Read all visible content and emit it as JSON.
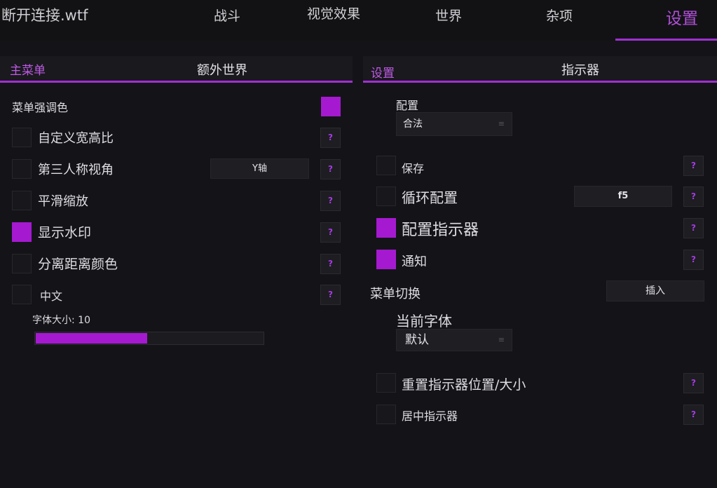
{
  "app": {
    "title": "断开连接.wtf"
  },
  "tabs": [
    {
      "label": "战斗"
    },
    {
      "label": "视觉效果"
    },
    {
      "label": "世界"
    },
    {
      "label": "杂项"
    },
    {
      "label": "设置"
    }
  ],
  "left_panel": {
    "section": "主菜单",
    "subtitle": "额外世界",
    "accent_label": "菜单强调色",
    "accent_color": "#a51ad0",
    "options": [
      {
        "label": "自定义宽高比",
        "checked": false
      },
      {
        "label": "第三人称视角",
        "checked": false,
        "keybind": "Y轴"
      },
      {
        "label": "平滑缩放",
        "checked": false
      },
      {
        "label": "显示水印",
        "checked": true
      },
      {
        "label": "分离距离颜色",
        "checked": false
      },
      {
        "label": "中文",
        "checked": false
      }
    ],
    "font_size": {
      "label": "字体大小: 10",
      "value": 10,
      "fraction": 0.49
    }
  },
  "right_panel": {
    "section": "设置",
    "subtitle": "指示器",
    "config": {
      "label": "配置",
      "value": "合法"
    },
    "options": [
      {
        "label": "保存",
        "checked": false
      },
      {
        "label": "循环配置",
        "checked": false,
        "keybind": "f5"
      },
      {
        "label": "配置指示器",
        "checked": true
      },
      {
        "label": "通知",
        "checked": true
      }
    ],
    "menu_toggle": {
      "label": "菜单切换",
      "keybind": "插入"
    },
    "current_font": {
      "label": "当前字体",
      "value": "默认"
    },
    "bottom_options": [
      {
        "label": "重置指示器位置/大小",
        "checked": false
      },
      {
        "label": "居中指示器",
        "checked": false
      }
    ]
  },
  "help_glyph": "?",
  "combo_glyph": "≡",
  "colors": {
    "accent": "#a51ad0",
    "accent_text": "#c05ae6",
    "background": "#141418"
  }
}
